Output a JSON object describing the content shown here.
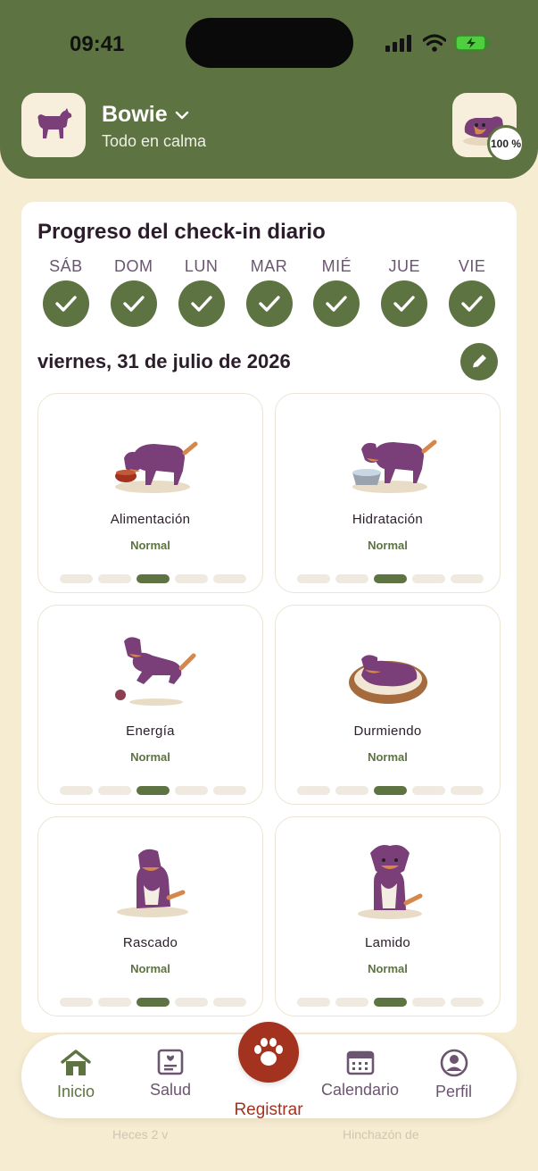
{
  "status_bar": {
    "time": "09:41"
  },
  "header": {
    "pet_name": "Bowie",
    "pet_status": "Todo en calma",
    "completion": "100 %",
    "icons": {
      "avatar": "dog-silhouette-icon",
      "dropdown": "chevron-down-icon"
    }
  },
  "checkin": {
    "title": "Progreso del check-in diario",
    "days": [
      {
        "label": "SÁB",
        "done": true
      },
      {
        "label": "DOM",
        "done": true
      },
      {
        "label": "LUN",
        "done": true
      },
      {
        "label": "MAR",
        "done": true
      },
      {
        "label": "MIÉ",
        "done": true
      },
      {
        "label": "JUE",
        "done": true
      },
      {
        "label": "VIE",
        "done": true
      }
    ],
    "date": "viernes, 31 de julio de 2026"
  },
  "tiles": [
    {
      "name": "Alimentación",
      "value": "Normal",
      "level": 3,
      "of": 5,
      "icon": "dog-eating-icon"
    },
    {
      "name": "Hidratación",
      "value": "Normal",
      "level": 3,
      "of": 5,
      "icon": "dog-drinking-icon"
    },
    {
      "name": "Energía",
      "value": "Normal",
      "level": 3,
      "of": 5,
      "icon": "dog-playing-icon"
    },
    {
      "name": "Durmiendo",
      "value": "Normal",
      "level": 3,
      "of": 5,
      "icon": "dog-sleeping-icon"
    },
    {
      "name": "Rascado",
      "value": "Normal",
      "level": 3,
      "of": 5,
      "icon": "dog-scratching-icon"
    },
    {
      "name": "Lamido",
      "value": "Normal",
      "level": 3,
      "of": 5,
      "icon": "dog-sitting-icon"
    }
  ],
  "partial_tiles": [
    "Heces 2 v",
    "Hinchazón de"
  ],
  "nav": {
    "items": [
      {
        "label": "Inicio",
        "icon": "home-icon",
        "active": true
      },
      {
        "label": "Salud",
        "icon": "health-record-icon",
        "active": false
      },
      {
        "label": "Registrar",
        "icon": "paw-icon",
        "active": false
      },
      {
        "label": "Calendario",
        "icon": "calendar-icon",
        "active": false
      },
      {
        "label": "Perfil",
        "icon": "profile-icon",
        "active": false
      }
    ]
  },
  "colors": {
    "primary": "#5d7341",
    "accent": "#a3321e",
    "background": "#f6ecd2",
    "dog": "#7a3e78"
  }
}
